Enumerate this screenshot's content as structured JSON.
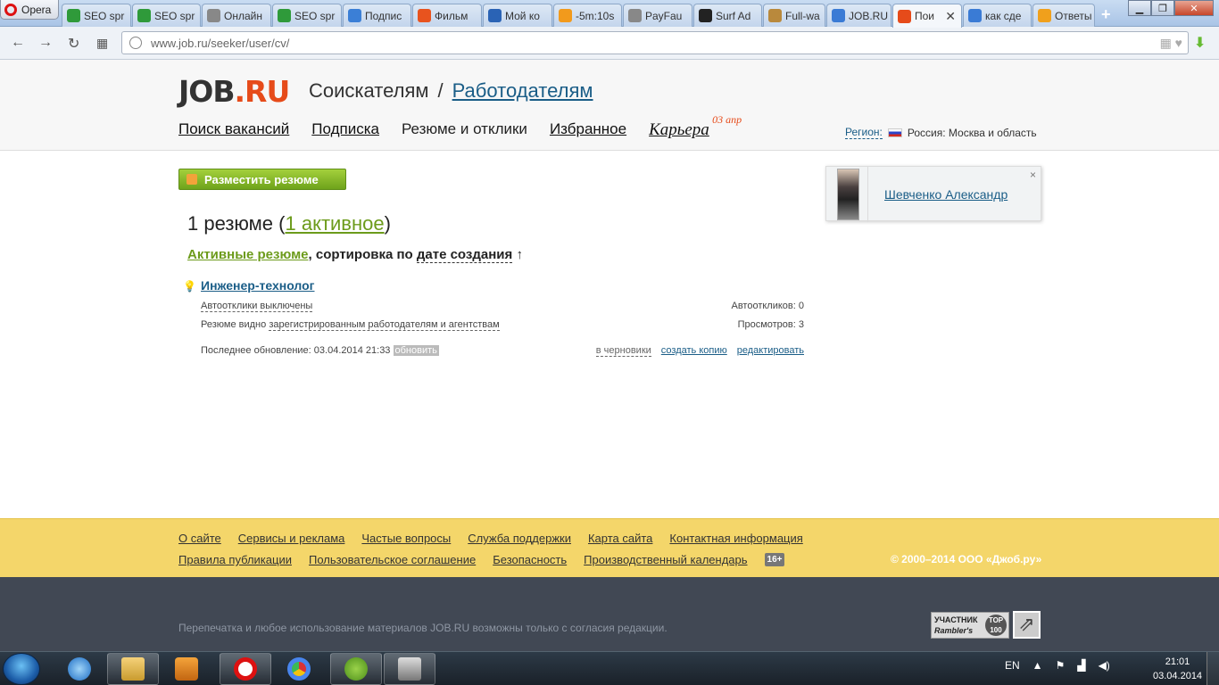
{
  "browser": {
    "menu_label": "Opera",
    "tabs": [
      {
        "title": "SEO spr",
        "icon": "seo-sprint-icon",
        "color": "#2f9a3a"
      },
      {
        "title": "SEO spr",
        "icon": "seo-sprint-icon",
        "color": "#2f9a3a"
      },
      {
        "title": "Онлайн",
        "icon": "page-icon",
        "color": "#888888"
      },
      {
        "title": "SEO spr",
        "icon": "seo-sprint-icon",
        "color": "#2f9a3a"
      },
      {
        "title": "Подпис",
        "icon": "heart-icon",
        "color": "#3b7fd6"
      },
      {
        "title": "Фильм",
        "icon": "kinopoisk-icon",
        "color": "#e8531e"
      },
      {
        "title": "Мой ко",
        "icon": "cube-icon",
        "color": "#2a63b5"
      },
      {
        "title": "-5m:10s",
        "icon": "bitcoin-icon",
        "color": "#f29a1c"
      },
      {
        "title": "PayFau",
        "icon": "page-icon",
        "color": "#888888"
      },
      {
        "title": "Surf Ad",
        "icon": "surf-icon",
        "color": "#222222"
      },
      {
        "title": "Full-wa",
        "icon": "box-icon",
        "color": "#b9893c"
      },
      {
        "title": "JOB.RU",
        "icon": "opera-speed-icon",
        "color": "#3a7bd5"
      },
      {
        "title": "Пои",
        "icon": "job-icon",
        "color": "#e64b1a",
        "active": true
      },
      {
        "title": "как сде",
        "icon": "google-icon",
        "color": "#3a7bd5"
      },
      {
        "title": "Ответы",
        "icon": "question-icon",
        "color": "#f0a01c"
      }
    ],
    "url": "www.job.ru/seeker/user/cv/"
  },
  "header": {
    "logo_main": "JOB",
    "logo_dot": ".",
    "logo_ru": "RU",
    "role_seekers": "Соискателям",
    "role_separator": "/",
    "role_employers": "Работодателям",
    "nav": {
      "search": "Поиск вакансий",
      "subscription": "Подписка",
      "cv_responses": "Резюме и отклики",
      "favorites": "Избранное",
      "career": "Карьера",
      "career_badge": "03 апр"
    },
    "region_label": "Регион:",
    "region_value": "Россия: Москва и область"
  },
  "main": {
    "post_button": "Разместить резюме",
    "cv_count_prefix": "1 резюме (",
    "cv_count_active": "1 активное",
    "cv_count_suffix": ")",
    "sort_active": "Активные резюме",
    "sort_text": ", сортировка по",
    "sort_field": "дате создания",
    "sort_arrow": "↑",
    "cv": {
      "title": "Инженер-технолог",
      "auto_responses": "Автоотклики выключены",
      "visibility_prefix": "Резюме видно",
      "visibility_link": "зарегистрированным работодателям и агентствам",
      "auto_count_label": "Автооткликов: 0",
      "views_label": "Просмотров: 3",
      "updated_label": "Последнее обновление: 03.04.2014 21:33",
      "refresh": "обновить",
      "to_drafts": "в черновики",
      "create_copy": "создать копию",
      "edit": "редактировать"
    }
  },
  "user": {
    "name": "Шевченко Александр",
    "close": "×"
  },
  "footer": {
    "row1": [
      "О сайте",
      "Сервисы и реклама",
      "Частые вопросы",
      "Служба поддержки",
      "Карта сайта",
      "Контактная информация"
    ],
    "row2": [
      "Правила публикации",
      "Пользовательское соглашение",
      "Безопасность",
      "Производственный календарь"
    ],
    "age": "16+",
    "copyright": "© 2000–2014 ООО «Джоб.ру»",
    "disclaimer": "Перепечатка и любое использование материалов JOB.RU возможны только с согласия редакции.",
    "rambler_line1": "УЧАСТНИК",
    "rambler_line2": "Rambler's",
    "rambler_top": "TOP 100"
  },
  "taskbar": {
    "lang": "EN",
    "time": "21:01",
    "date": "03.04.2014"
  }
}
